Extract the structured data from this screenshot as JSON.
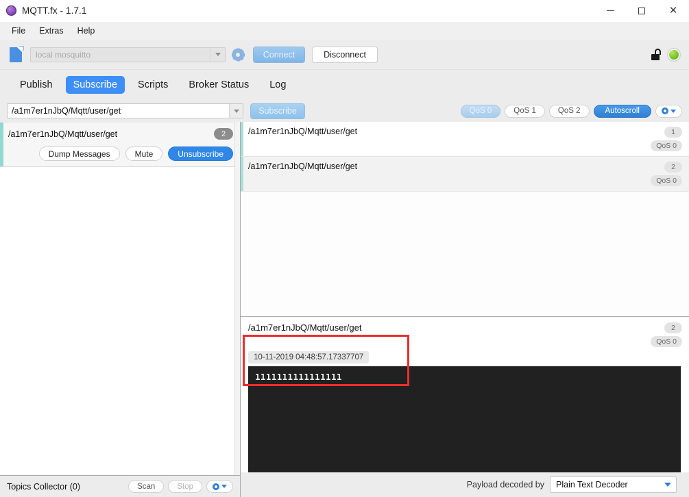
{
  "window": {
    "title": "MQTT.fx - 1.7.1",
    "app_icon": "mqttfx-logo-icon",
    "controls": {
      "minimize": "minimize-icon",
      "maximize": "maximize-icon",
      "close": "close-icon"
    }
  },
  "menu": {
    "items": [
      "File",
      "Extras",
      "Help"
    ]
  },
  "connection_bar": {
    "file_icon": "new-file-icon",
    "profile": {
      "value": "local mosquitto",
      "placeholder": "local mosquitto"
    },
    "settings_icon": "gear-icon",
    "connect_label": "Connect",
    "connect_enabled": false,
    "disconnect_label": "Disconnect",
    "disconnect_enabled": true,
    "lock_icon": "unlocked-padlock-icon",
    "status_icon": "connection-status-led",
    "status_color": "#7dc72a"
  },
  "tabs": {
    "items": [
      {
        "label": "Publish",
        "active": false
      },
      {
        "label": "Subscribe",
        "active": true
      },
      {
        "label": "Scripts",
        "active": false
      },
      {
        "label": "Broker Status",
        "active": false
      },
      {
        "label": "Log",
        "active": false
      }
    ],
    "active_color": "#3d8ef7"
  },
  "subscribe_bar": {
    "topic": {
      "value": "/a1m7er1nJbQ/Mqtt/user/get",
      "placeholder": "Topic"
    },
    "subscribe_label": "Subscribe",
    "subscribe_enabled": false,
    "qos_options": [
      {
        "label": "QoS 0",
        "selected": true
      },
      {
        "label": "QoS 1",
        "selected": false
      },
      {
        "label": "QoS 2",
        "selected": false
      }
    ],
    "autoscroll_label": "Autoscroll",
    "autoscroll_active": true,
    "options_icon": "gear-dropdown-icon"
  },
  "subscriptions": [
    {
      "topic": "/a1m7er1nJbQ/Mqtt/user/get",
      "count": "2",
      "accent_color": "#8fd9d2",
      "actions": [
        {
          "label": "Dump Messages",
          "primary": false
        },
        {
          "label": "Mute",
          "primary": false
        },
        {
          "label": "Unsubscribe",
          "primary": true
        }
      ]
    }
  ],
  "topics_collector": {
    "title": "Topics Collector (0)",
    "scan_label": "Scan",
    "scan_enabled": true,
    "stop_label": "Stop",
    "stop_enabled": false,
    "options_icon": "gear-dropdown-icon"
  },
  "messages": [
    {
      "topic": "/a1m7er1nJbQ/Mqtt/user/get",
      "index": "1",
      "qos": "QoS 0",
      "selected": false
    },
    {
      "topic": "/a1m7er1nJbQ/Mqtt/user/get",
      "index": "2",
      "qos": "QoS 0",
      "selected": true
    }
  ],
  "detail": {
    "topic": "/a1m7er1nJbQ/Mqtt/user/get",
    "index": "2",
    "qos": "QoS 0",
    "timestamp": "10-11-2019  04:48:57.17337707",
    "payload": "1111111111111111"
  },
  "footer": {
    "decoder_label": "Payload decoded by",
    "decoder_value": "Plain Text Decoder"
  },
  "annotation": {
    "color": "#ec2d2d",
    "shape": "rectangle-highlight"
  }
}
